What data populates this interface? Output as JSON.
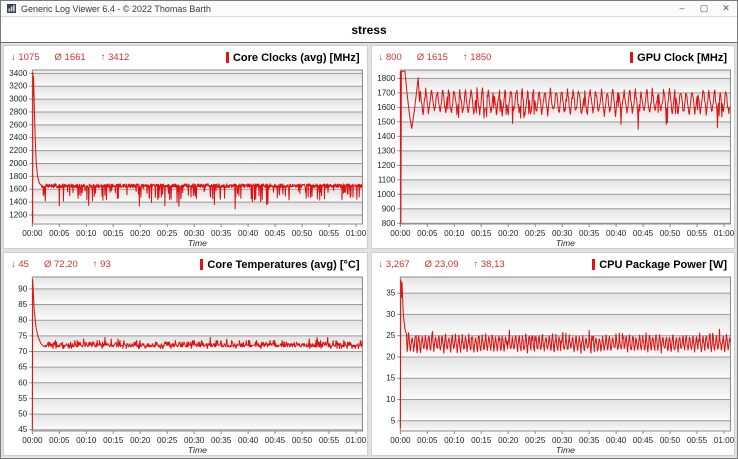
{
  "window": {
    "title": "Generic Log Viewer 6.4 - © 2022 Thomas Barth",
    "controls": {
      "minimize": "–",
      "maximize": "▢",
      "close": "✕"
    }
  },
  "header": {
    "title": "stress"
  },
  "colors": {
    "stats_red": "#cc3333",
    "line_red": "#de1010",
    "accent_bar_red": "#e01212",
    "grid": "#9b9b9b",
    "axis": "#8a8a8a",
    "band_top": "#e3e3e3",
    "band_bottom": "#fbfbfb",
    "tick_text": "#222222"
  },
  "chart_data": [
    {
      "id": "core-clocks",
      "type": "line",
      "title": "Core Clocks (avg) [MHz]",
      "stats": {
        "min": "↓ 1075",
        "avg": "Ø 1661",
        "max": "↑ 3412"
      },
      "summary": {
        "min": 1075,
        "avg": 1661,
        "max": 3412
      },
      "xlabel": "Time",
      "x_ticks": [
        "00:00",
        "00:05",
        "00:10",
        "00:15",
        "00:20",
        "00:25",
        "00:30",
        "00:35",
        "00:40",
        "00:45",
        "00:50",
        "00:55",
        "01:00"
      ],
      "x_axis": {
        "min": 0,
        "max": 61.2
      },
      "y_ticks": [
        3400,
        3200,
        3000,
        2800,
        2600,
        2400,
        2200,
        2000,
        1800,
        1600,
        1400,
        1200
      ],
      "y_axis": {
        "min": 1060,
        "max": 3452
      },
      "anchor_points": [
        [
          0,
          1260
        ],
        [
          0.05,
          1075
        ],
        [
          0.1,
          3412
        ],
        [
          0.16,
          3050
        ],
        [
          0.22,
          3350
        ],
        [
          0.35,
          2900
        ],
        [
          0.5,
          2450
        ],
        [
          0.7,
          2050
        ],
        [
          0.95,
          1800
        ],
        [
          1.3,
          1690
        ],
        [
          1.7,
          1660
        ]
      ],
      "series_synth": {
        "seed": 101,
        "pattern": "clock",
        "steady_start": 1.75,
        "step": 0.055,
        "baseline": 1653,
        "jitter": 62,
        "dip_prob": 0.1,
        "dip_min": 60,
        "dip_rand": 160,
        "deep_dip_prob": 0.012,
        "deep_dip": 260,
        "vmin": 1295,
        "vmax": 1702
      }
    },
    {
      "id": "gpu-clock",
      "type": "line",
      "title": "GPU Clock [MHz]",
      "stats": {
        "min": "↓ 800",
        "avg": "Ø 1615",
        "max": "↑ 1850"
      },
      "summary": {
        "min": 800,
        "avg": 1615,
        "max": 1850
      },
      "xlabel": "Time",
      "x_ticks": [
        "00:00",
        "00:05",
        "00:10",
        "00:15",
        "00:20",
        "00:25",
        "00:30",
        "00:35",
        "00:40",
        "00:45",
        "00:50",
        "00:55",
        "01:00"
      ],
      "x_axis": {
        "min": 0,
        "max": 61.2
      },
      "y_ticks": [
        1800,
        1700,
        1600,
        1500,
        1400,
        1300,
        1200,
        1100,
        1000,
        900,
        800
      ],
      "y_axis": {
        "min": 795,
        "max": 1858
      },
      "anchor_points": [
        [
          0,
          1850
        ],
        [
          0.1,
          800
        ],
        [
          0.14,
          1180
        ],
        [
          0.18,
          1850
        ],
        [
          0.85,
          1850
        ],
        [
          1.25,
          1690
        ],
        [
          1.7,
          1545
        ],
        [
          2.1,
          1455
        ],
        [
          2.55,
          1565
        ],
        [
          3.0,
          1705
        ],
        [
          3.3,
          1805
        ],
        [
          3.55,
          1640
        ]
      ],
      "series_synth": {
        "seed": 202,
        "pattern": "osc",
        "steady_start": 3.6,
        "step": 0.1,
        "baseline": 1638,
        "amplitude": 82,
        "period": 1.05,
        "jitter": 46,
        "dip_prob": 0.04,
        "dip": 110,
        "spike_prob": 0,
        "spike": 0,
        "vmin": 1448,
        "vmax": 1782
      }
    },
    {
      "id": "core-temperatures",
      "type": "line",
      "title": "Core Temperatures (avg) [°C]",
      "stats": {
        "min": "↓ 45",
        "avg": "Ø 72,20",
        "max": "↑ 93"
      },
      "summary": {
        "min": 45,
        "avg": 72.2,
        "max": 93
      },
      "xlabel": "Time",
      "x_ticks": [
        "00:00",
        "00:05",
        "00:10",
        "00:15",
        "00:20",
        "00:25",
        "00:30",
        "00:35",
        "00:40",
        "00:45",
        "00:50",
        "00:55",
        "01:00"
      ],
      "x_axis": {
        "min": 0,
        "max": 61.2
      },
      "y_ticks": [
        90,
        85,
        80,
        75,
        70,
        65,
        60,
        55,
        50,
        45
      ],
      "y_axis": {
        "min": 44.6,
        "max": 93.8
      },
      "anchor_points": [
        [
          0,
          45
        ],
        [
          0.06,
          93
        ],
        [
          0.35,
          83
        ],
        [
          0.7,
          77.5
        ],
        [
          1.1,
          74.5
        ],
        [
          1.6,
          72.5
        ],
        [
          2.2,
          71.5
        ]
      ],
      "series_synth": {
        "seed": 303,
        "pattern": "temp",
        "steady_start": 2.3,
        "step": 0.09,
        "baseline": 71.6,
        "quant": 0.5,
        "vmin": 70.5,
        "vmax": 74.5
      }
    },
    {
      "id": "cpu-package-power",
      "type": "line",
      "title": "CPU Package Power [W]",
      "stats": {
        "min": "↓ 3,267",
        "avg": "Ø 23,09",
        "max": "↑ 38,13"
      },
      "summary": {
        "min": 3.267,
        "avg": 23.09,
        "max": 38.13
      },
      "xlabel": "Time",
      "x_ticks": [
        "00:00",
        "00:05",
        "00:10",
        "00:15",
        "00:20",
        "00:25",
        "00:30",
        "00:35",
        "00:40",
        "00:45",
        "00:50",
        "00:55",
        "01:00"
      ],
      "x_axis": {
        "min": 0,
        "max": 61.2
      },
      "y_ticks": [
        35,
        30,
        25,
        20,
        15,
        10,
        5
      ],
      "y_axis": {
        "min": 2.6,
        "max": 38.8
      },
      "anchor_points": [
        [
          0,
          3.267
        ],
        [
          0.07,
          38.13
        ],
        [
          0.2,
          34
        ],
        [
          0.3,
          37.6
        ],
        [
          0.55,
          30
        ],
        [
          0.85,
          26.6
        ],
        [
          1.15,
          25.3
        ]
      ],
      "series_synth": {
        "seed": 404,
        "pattern": "osc",
        "steady_start": 1.25,
        "step": 0.08,
        "baseline": 23.2,
        "amplitude": 1.9,
        "period": 0.62,
        "jitter": 1.1,
        "dip_prob": 0,
        "dip": 0,
        "spike_prob": 0.03,
        "spike": 1.6,
        "vmin": 20.7,
        "vmax": 26.5
      }
    }
  ]
}
